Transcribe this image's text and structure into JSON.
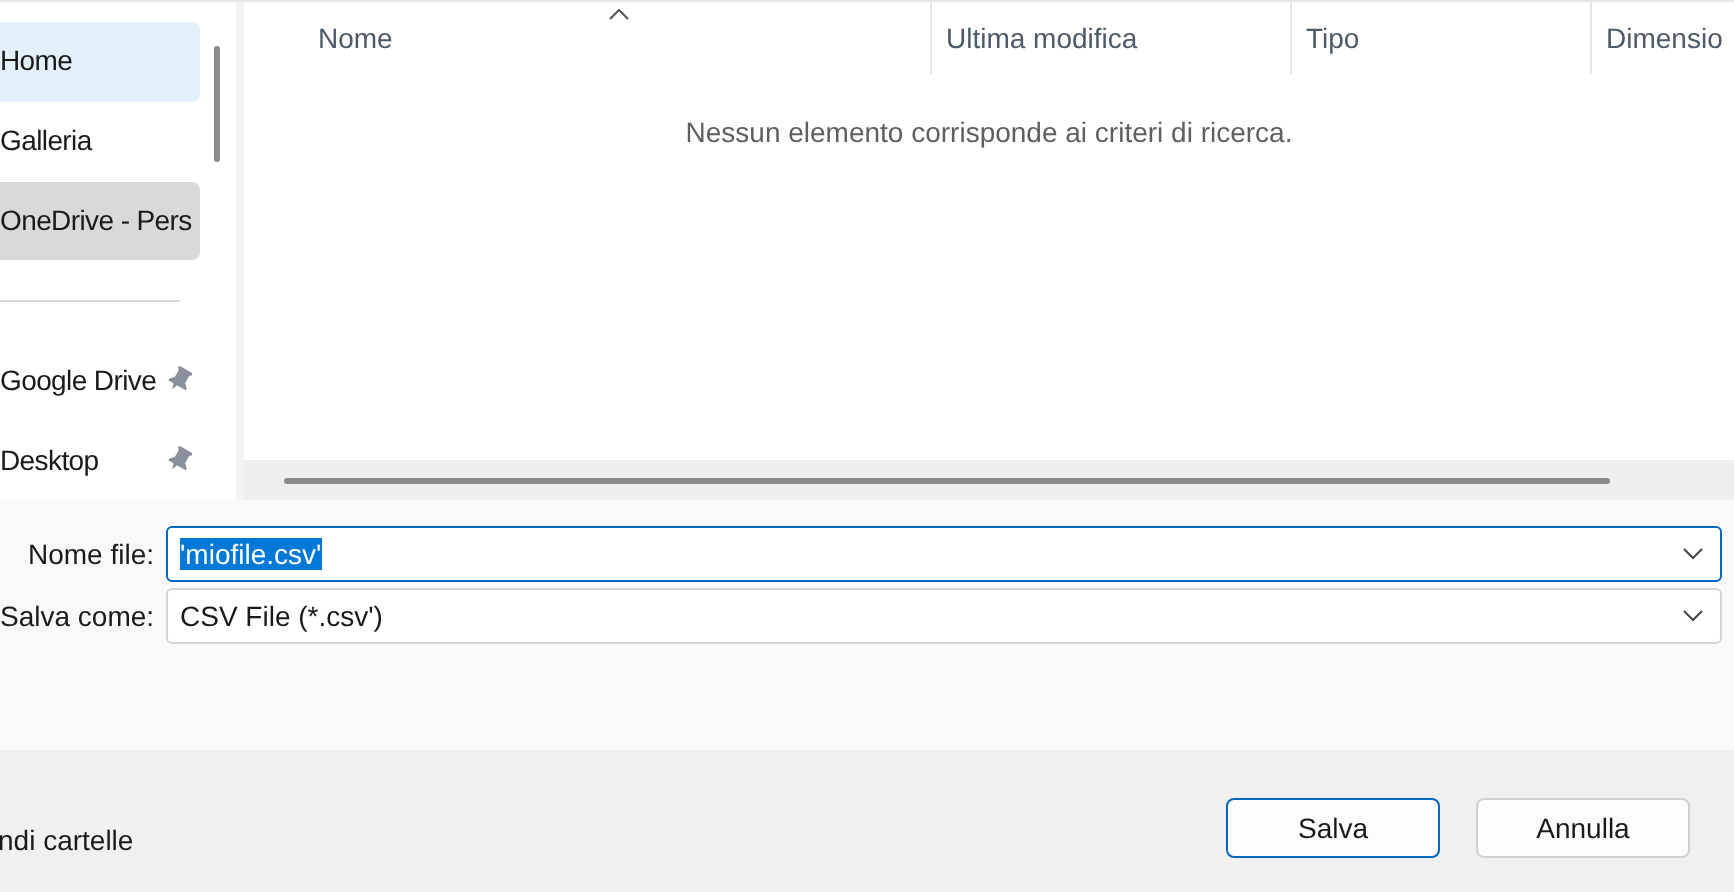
{
  "sidebar": {
    "items": [
      {
        "label": "Home",
        "selected": true,
        "highlighted": false,
        "pinned": false
      },
      {
        "label": "Galleria",
        "selected": false,
        "highlighted": false,
        "pinned": false
      },
      {
        "label": "OneDrive - Pers",
        "selected": false,
        "highlighted": true,
        "pinned": false
      },
      {
        "kind": "divider"
      },
      {
        "label": "Google Drive",
        "selected": false,
        "highlighted": false,
        "pinned": true
      },
      {
        "label": "Desktop",
        "selected": false,
        "highlighted": false,
        "pinned": true
      }
    ]
  },
  "file_list": {
    "columns": [
      {
        "label": "Nome",
        "sorted": true
      },
      {
        "label": "Ultima modifica",
        "sorted": false
      },
      {
        "label": "Tipo",
        "sorted": false
      },
      {
        "label": "Dimensio",
        "sorted": false
      }
    ],
    "empty_message": "Nessun elemento corrisponde ai criteri di ricerca."
  },
  "form": {
    "fields": [
      {
        "label": "Nome file:",
        "value": "'miofile.csv'",
        "focused": true
      },
      {
        "label": "Salva come:",
        "value": "CSV File (*.csv')",
        "focused": false
      }
    ]
  },
  "footer": {
    "toggle_label": "ndi cartelle",
    "buttons": [
      {
        "label": "Salva",
        "default": true
      },
      {
        "label": "Annulla",
        "default": false
      }
    ]
  }
}
